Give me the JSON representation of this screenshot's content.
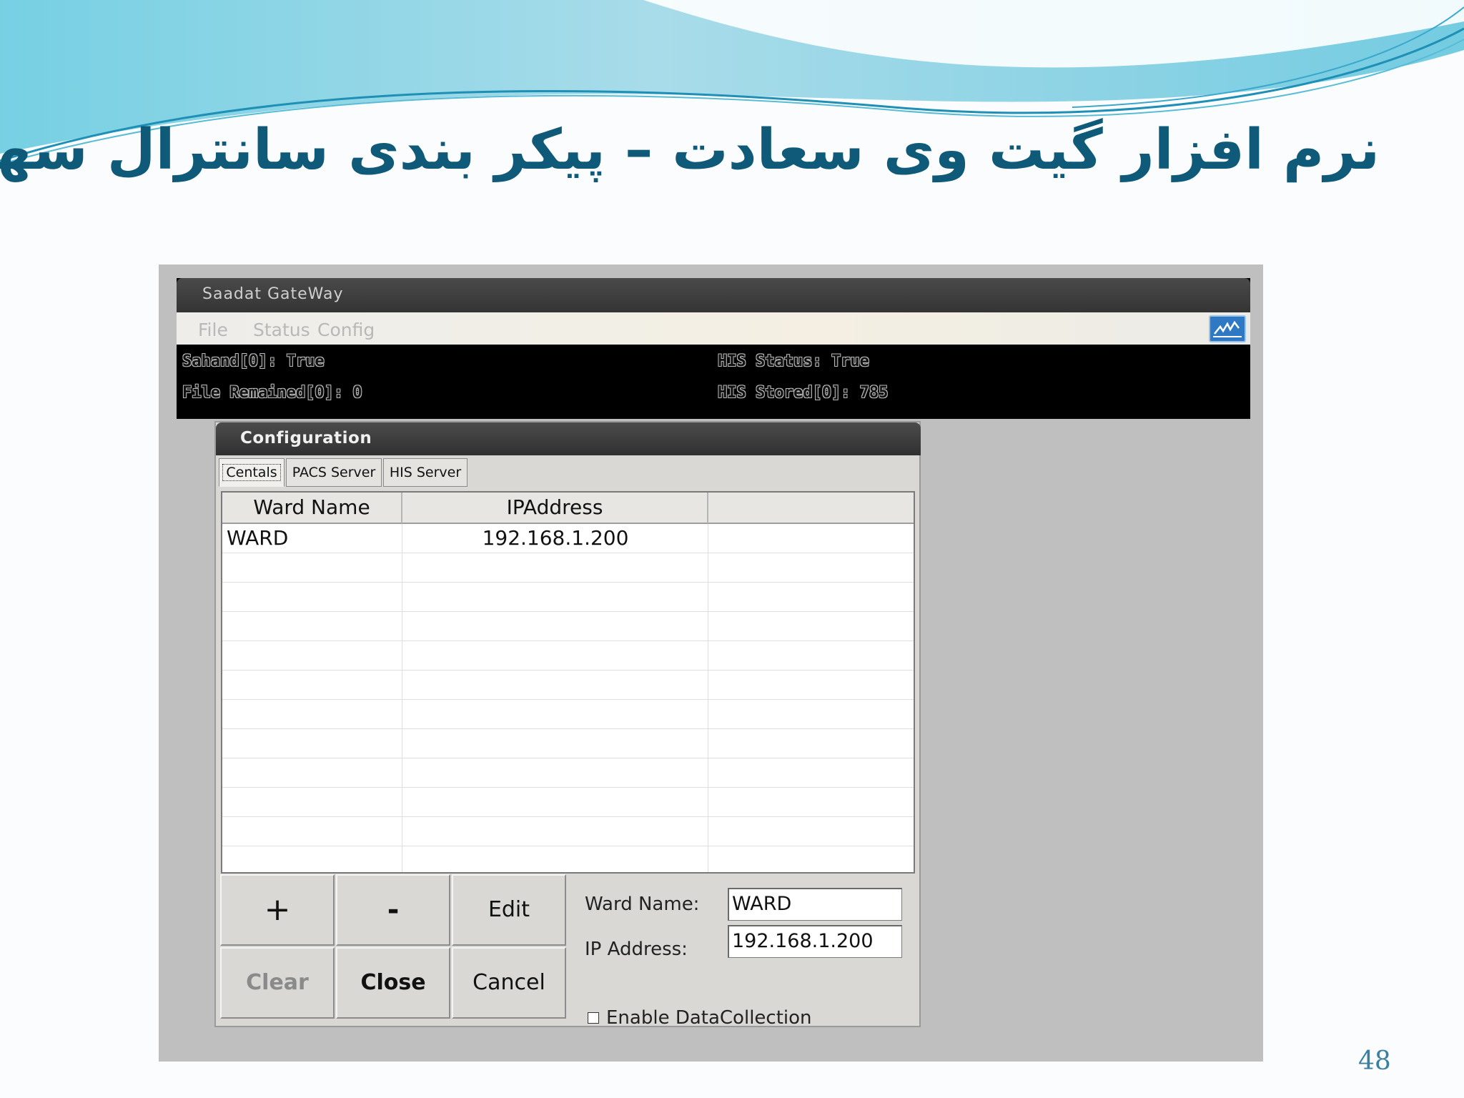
{
  "slide": {
    "title": "نرم افزار گیت وی سعادت – پیکر بندی سانترال سهند",
    "page_number": "48"
  },
  "app": {
    "title": "Saadat GateWay",
    "menu": [
      "File",
      "Status",
      "Config"
    ],
    "status": {
      "sahand": "Sahand[0]: True",
      "file_remained": "File Remained[0]: 0",
      "his_status": "HIS Status: True",
      "his_stored": "HIS Stored[0]: 785"
    }
  },
  "config": {
    "title": "Configuration",
    "tabs": [
      "Centals",
      "PACS Server",
      "HIS Server"
    ],
    "active_tab": "Centals",
    "table": {
      "columns": [
        "Ward Name",
        "IPAddress",
        ""
      ],
      "rows": [
        {
          "ward_name": "WARD",
          "ip": "192.168.1.200"
        }
      ]
    },
    "buttons": {
      "add": "+",
      "remove": "-",
      "edit": "Edit",
      "clear": "Clear",
      "close": "Close",
      "cancel": "Cancel"
    },
    "form": {
      "ward_name_label": "Ward Name:",
      "ward_name_value": "WARD",
      "ip_label": "IP Address:",
      "ip_value": "192.168.1.200",
      "checkbox_label": "Enable DataCollection",
      "checkbox_checked": false
    }
  },
  "colors": {
    "title": "#0f5a78",
    "wave_light": "#7fd3e6",
    "wave_dark": "#1e8fb5"
  }
}
